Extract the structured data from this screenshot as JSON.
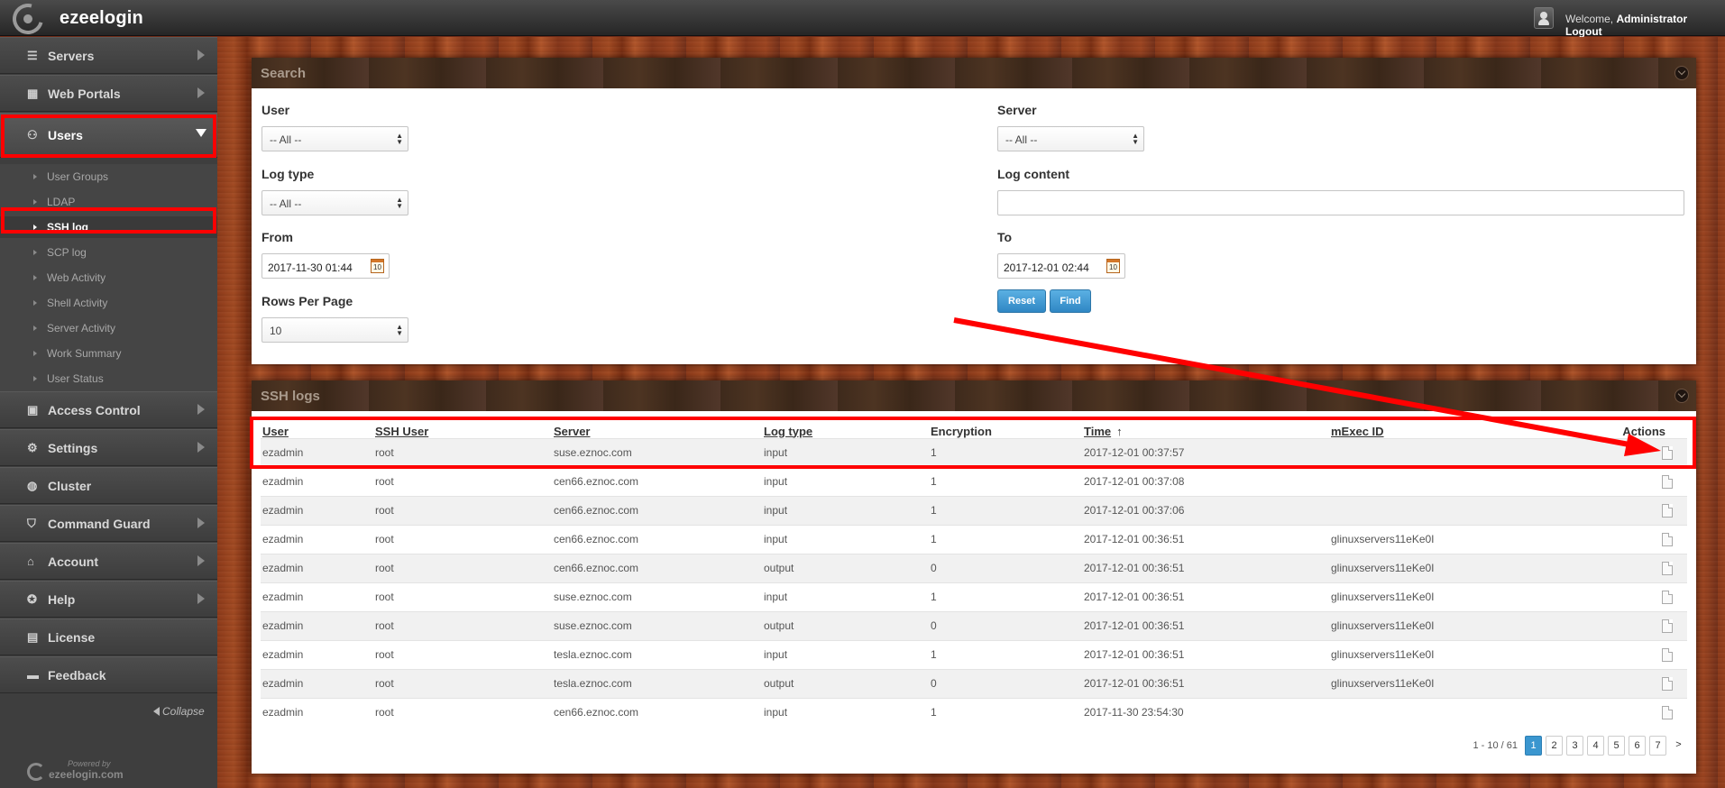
{
  "app": {
    "name": "ezeelogin"
  },
  "topbar": {
    "welcome_prefix": "Welcome,",
    "user": "Administrator",
    "logout": "Logout"
  },
  "sidebar": {
    "items": [
      {
        "label": "Servers",
        "icon": "list-icon"
      },
      {
        "label": "Web Portals",
        "icon": "grid-icon"
      },
      {
        "label": "Users",
        "icon": "users-icon"
      },
      {
        "label": "Access Control",
        "icon": "lock-icon"
      },
      {
        "label": "Settings",
        "icon": "gears-icon"
      },
      {
        "label": "Cluster",
        "icon": "globe-icon"
      },
      {
        "label": "Command Guard",
        "icon": "shield-icon"
      },
      {
        "label": "Account",
        "icon": "home-icon"
      },
      {
        "label": "Help",
        "icon": "lifebuoy-icon"
      },
      {
        "label": "License",
        "icon": "license-icon"
      },
      {
        "label": "Feedback",
        "icon": "chat-icon"
      }
    ],
    "submenu": [
      "User Groups",
      "LDAP",
      "SSH log",
      "SCP log",
      "Web Activity",
      "Shell Activity",
      "Server Activity",
      "Work Summary",
      "User Status"
    ],
    "active_item": "Users",
    "active_sub": "SSH log",
    "collapse": "Collapse",
    "powered_by": "Powered by",
    "powered_brand": "ezeelogin.com"
  },
  "search": {
    "title": "Search",
    "user_label": "User",
    "user_value": "-- All --",
    "logtype_label": "Log type",
    "logtype_value": "-- All --",
    "from_label": "From",
    "from_value": "2017-11-30 01:44",
    "rows_label": "Rows Per Page",
    "rows_value": "10",
    "server_label": "Server",
    "server_value": "-- All --",
    "logcontent_label": "Log content",
    "logcontent_value": "",
    "to_label": "To",
    "to_value": "2017-12-01 02:44",
    "calendar_day": "10",
    "reset": "Reset",
    "find": "Find"
  },
  "logs": {
    "title": "SSH logs",
    "columns": [
      "User",
      "SSH User",
      "Server",
      "Log type",
      "Encryption",
      "Time",
      "mExec ID",
      "Actions"
    ],
    "rows": [
      [
        "ezadmin",
        "root",
        "suse.eznoc.com",
        "input",
        "1",
        "2017-12-01 00:37:57",
        ""
      ],
      [
        "ezadmin",
        "root",
        "cen66.eznoc.com",
        "input",
        "1",
        "2017-12-01 00:37:08",
        ""
      ],
      [
        "ezadmin",
        "root",
        "cen66.eznoc.com",
        "input",
        "1",
        "2017-12-01 00:37:06",
        ""
      ],
      [
        "ezadmin",
        "root",
        "cen66.eznoc.com",
        "input",
        "1",
        "2017-12-01 00:36:51",
        "glinuxservers11eKe0I"
      ],
      [
        "ezadmin",
        "root",
        "cen66.eznoc.com",
        "output",
        "0",
        "2017-12-01 00:36:51",
        "glinuxservers11eKe0I"
      ],
      [
        "ezadmin",
        "root",
        "suse.eznoc.com",
        "input",
        "1",
        "2017-12-01 00:36:51",
        "glinuxservers11eKe0I"
      ],
      [
        "ezadmin",
        "root",
        "suse.eznoc.com",
        "output",
        "0",
        "2017-12-01 00:36:51",
        "glinuxservers11eKe0I"
      ],
      [
        "ezadmin",
        "root",
        "tesla.eznoc.com",
        "input",
        "1",
        "2017-12-01 00:36:51",
        "glinuxservers11eKe0I"
      ],
      [
        "ezadmin",
        "root",
        "tesla.eznoc.com",
        "output",
        "0",
        "2017-12-01 00:36:51",
        "glinuxservers11eKe0I"
      ],
      [
        "ezadmin",
        "root",
        "cen66.eznoc.com",
        "input",
        "1",
        "2017-11-30 23:54:30",
        ""
      ]
    ],
    "pagination": {
      "info": "1 - 10 / 61",
      "pages": [
        "1",
        "2",
        "3",
        "4",
        "5",
        "6",
        "7"
      ],
      "current": "1",
      "next": ">"
    }
  },
  "colors": {
    "annotation": "#ff0000",
    "accent": "#3a96cf"
  }
}
